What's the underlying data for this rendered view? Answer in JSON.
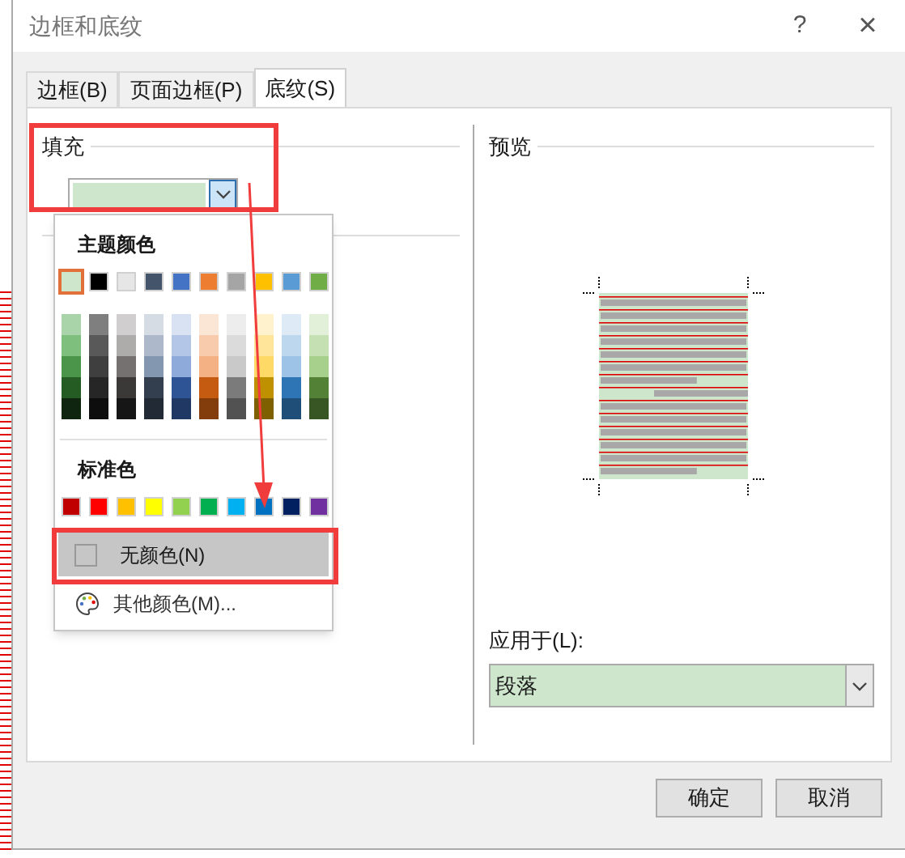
{
  "window": {
    "title": "边框和底纹",
    "help": "?",
    "close": "×"
  },
  "tabs": [
    {
      "label": "边框(B)",
      "selected": false
    },
    {
      "label": "页面边框(P)",
      "selected": false
    },
    {
      "label": "底纹(S)",
      "selected": true
    }
  ],
  "fill": {
    "label": "填充",
    "color": "#cde6cc"
  },
  "color_menu": {
    "theme_title": "主题颜色",
    "theme": [
      {
        "color": "#cde6cc",
        "selected": true
      },
      {
        "color": "#000000",
        "selected": false
      },
      {
        "color": "#e7e6e6",
        "selected": false
      },
      {
        "color": "#44546a",
        "selected": false
      },
      {
        "color": "#4472c4",
        "selected": false
      },
      {
        "color": "#ed7d31",
        "selected": false
      },
      {
        "color": "#a5a5a5",
        "selected": false
      },
      {
        "color": "#ffc000",
        "selected": false
      },
      {
        "color": "#5b9bd5",
        "selected": false
      },
      {
        "color": "#70ad47",
        "selected": false
      }
    ],
    "shades": [
      [
        {
          "color": "#a9d3a8"
        },
        {
          "color": "#7fbf7e"
        },
        {
          "color": "#4a954a"
        },
        {
          "color": "#245c24"
        },
        {
          "color": "#0f250f"
        }
      ],
      [
        {
          "color": "#7f7f7f"
        },
        {
          "color": "#595959"
        },
        {
          "color": "#3f3f3f"
        },
        {
          "color": "#262626"
        },
        {
          "color": "#0d0d0d"
        }
      ],
      [
        {
          "color": "#d0cece"
        },
        {
          "color": "#aeabab"
        },
        {
          "color": "#757171"
        },
        {
          "color": "#3b3838"
        },
        {
          "color": "#161616"
        }
      ],
      [
        {
          "color": "#d6dce4"
        },
        {
          "color": "#adb9ca"
        },
        {
          "color": "#8497b0"
        },
        {
          "color": "#333f4f"
        },
        {
          "color": "#222a35"
        }
      ],
      [
        {
          "color": "#d9e2f3"
        },
        {
          "color": "#b4c6e7"
        },
        {
          "color": "#8eaadb"
        },
        {
          "color": "#2f5496"
        },
        {
          "color": "#1f3864"
        }
      ],
      [
        {
          "color": "#fbe5d5"
        },
        {
          "color": "#f7cbac"
        },
        {
          "color": "#f4b183"
        },
        {
          "color": "#c55a11"
        },
        {
          "color": "#833c0b"
        }
      ],
      [
        {
          "color": "#ededed"
        },
        {
          "color": "#dbdbdb"
        },
        {
          "color": "#c9c9c9"
        },
        {
          "color": "#7b7b7b"
        },
        {
          "color": "#525252"
        }
      ],
      [
        {
          "color": "#fff2cc"
        },
        {
          "color": "#fee599"
        },
        {
          "color": "#ffd965"
        },
        {
          "color": "#bf9000"
        },
        {
          "color": "#7f6000"
        }
      ],
      [
        {
          "color": "#deebf6"
        },
        {
          "color": "#bdd7ee"
        },
        {
          "color": "#9dc3e6"
        },
        {
          "color": "#2e75b5"
        },
        {
          "color": "#1f4e79"
        }
      ],
      [
        {
          "color": "#e2efd9"
        },
        {
          "color": "#c5e0b3"
        },
        {
          "color": "#a8d08d"
        },
        {
          "color": "#538135"
        },
        {
          "color": "#375623"
        }
      ]
    ],
    "standard_title": "标准色",
    "standard": [
      {
        "color": "#c00000",
        "selected": false
      },
      {
        "color": "#ff0000",
        "selected": false
      },
      {
        "color": "#ffc000",
        "selected": false
      },
      {
        "color": "#ffff00",
        "selected": false
      },
      {
        "color": "#92d050",
        "selected": false
      },
      {
        "color": "#00b050",
        "selected": false
      },
      {
        "color": "#00b0f0",
        "selected": false
      },
      {
        "color": "#0070c0",
        "selected": false
      },
      {
        "color": "#002060",
        "selected": false
      },
      {
        "color": "#7030a0",
        "selected": false
      }
    ],
    "no_color": {
      "label": "无颜色(N)",
      "selected": true
    },
    "more_colors": {
      "label": "其他颜色(M)...",
      "selected": false
    }
  },
  "preview": {
    "label": "预览"
  },
  "apply_to": {
    "label": "应用于(L):",
    "value": "段落"
  },
  "buttons": [
    "确定",
    "取消"
  ]
}
